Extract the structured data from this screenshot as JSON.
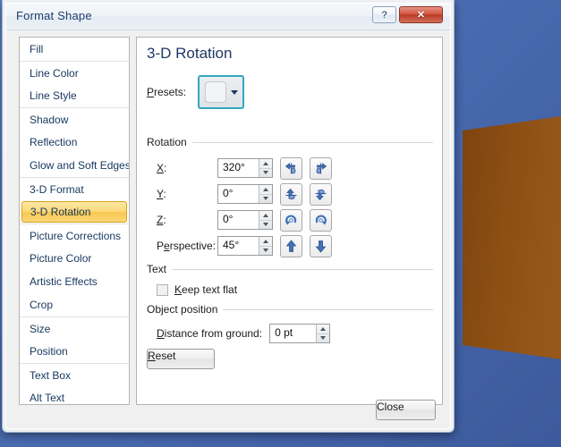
{
  "window": {
    "title": "Format Shape",
    "help_label": "?",
    "close_label": "✕"
  },
  "sidebar": {
    "items": [
      {
        "label": "Fill",
        "selected": false,
        "separator": false
      },
      {
        "label": "Line Color",
        "selected": false,
        "separator": true
      },
      {
        "label": "Line Style",
        "selected": false,
        "separator": false
      },
      {
        "label": "Shadow",
        "selected": false,
        "separator": true
      },
      {
        "label": "Reflection",
        "selected": false,
        "separator": false
      },
      {
        "label": "Glow and Soft Edges",
        "selected": false,
        "separator": false
      },
      {
        "label": "3-D Format",
        "selected": false,
        "separator": true
      },
      {
        "label": "3-D Rotation",
        "selected": true,
        "separator": false
      },
      {
        "label": "Picture Corrections",
        "selected": false,
        "separator": true
      },
      {
        "label": "Picture Color",
        "selected": false,
        "separator": false
      },
      {
        "label": "Artistic Effects",
        "selected": false,
        "separator": false
      },
      {
        "label": "Crop",
        "selected": false,
        "separator": false
      },
      {
        "label": "Size",
        "selected": false,
        "separator": true
      },
      {
        "label": "Position",
        "selected": false,
        "separator": false
      },
      {
        "label": "Text Box",
        "selected": false,
        "separator": true
      },
      {
        "label": "Alt Text",
        "selected": false,
        "separator": false
      }
    ]
  },
  "panel": {
    "title": "3-D Rotation",
    "presets_label": "Presets:",
    "rotation_group": "Rotation",
    "rows": [
      {
        "label": "X:",
        "value": "320°"
      },
      {
        "label": "Y:",
        "value": "0°"
      },
      {
        "label": "Z:",
        "value": "0°"
      },
      {
        "label": "Perspective:",
        "value": "45°"
      }
    ],
    "text_group": "Text",
    "keep_text_flat_label": "Keep text flat",
    "object_position_group": "Object position",
    "distance_label": "Distance from ground:",
    "distance_value": "0 pt",
    "reset_label": "Reset"
  },
  "footer": {
    "close_label": "Close"
  },
  "desktop": {
    "shape_color": "#8a4d12",
    "background_top": "#5b7fc4",
    "background_bottom": "#3c5a9c"
  }
}
